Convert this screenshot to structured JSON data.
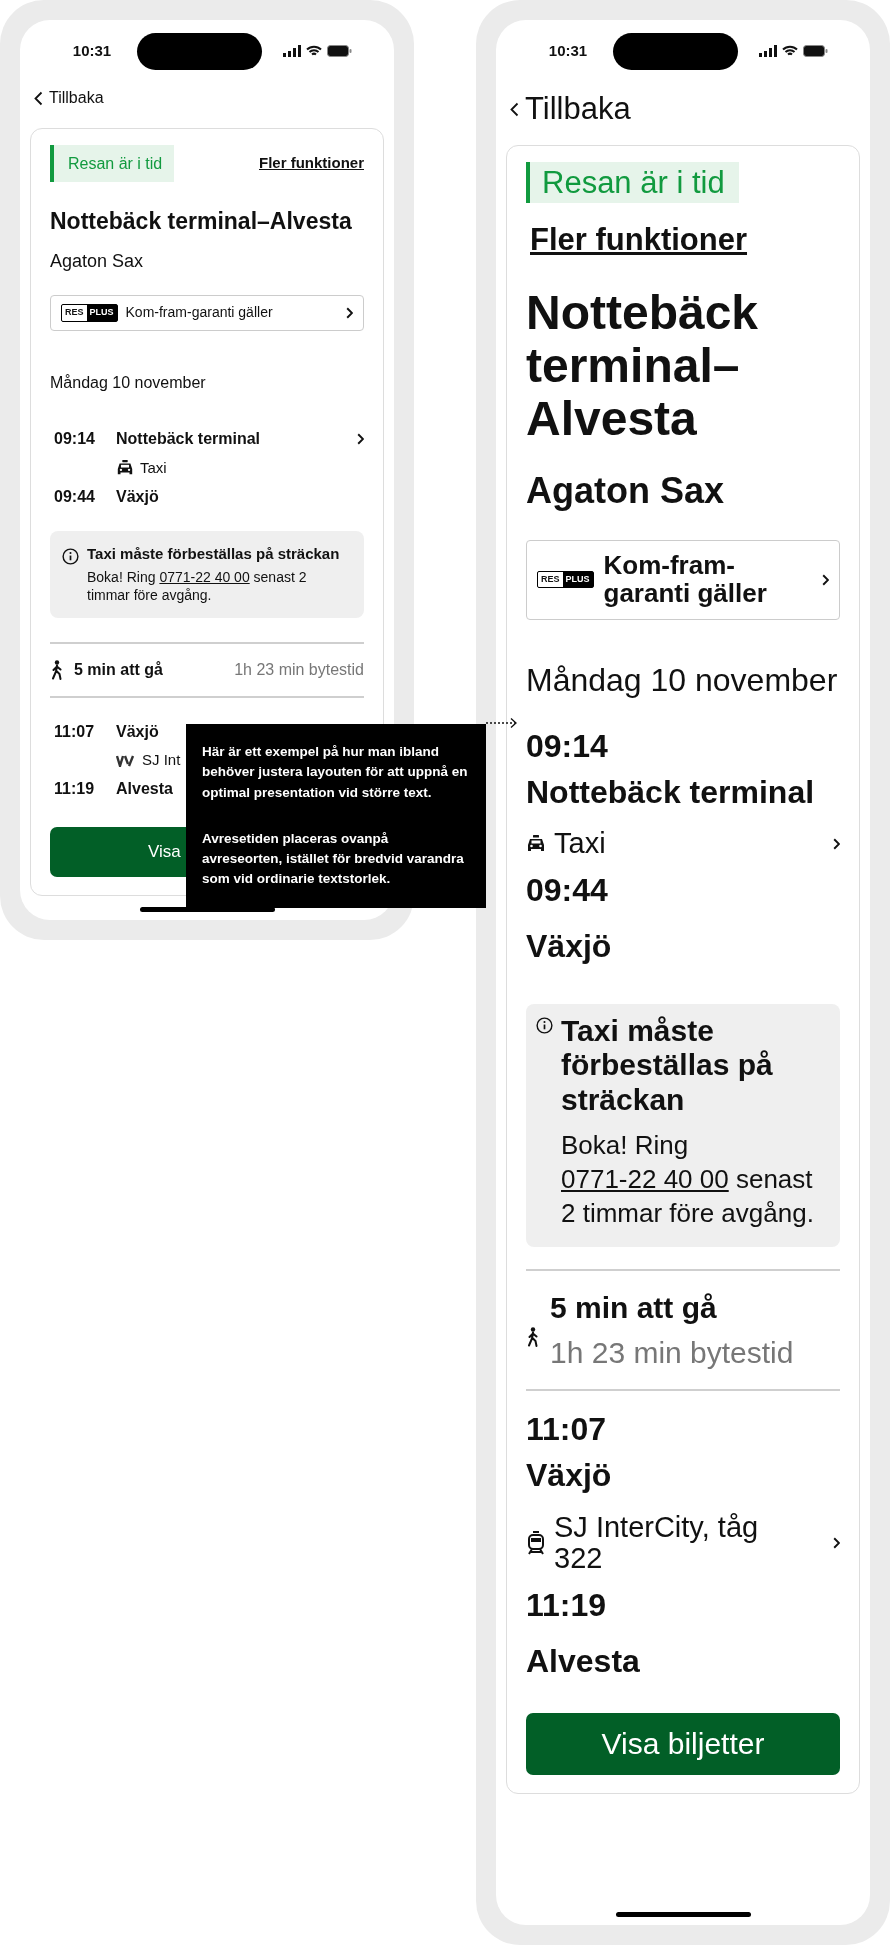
{
  "phones": [
    {
      "kind": "standard",
      "status_time": "10:31",
      "back": "Tillbaka",
      "trip_status": "Resan är i tid",
      "more_link": "Fler funktioner",
      "title": "Nottebäck terminal–Alvesta",
      "passenger": "Agaton Sax",
      "guarantee": {
        "logo_left": "RES",
        "logo_right": "PLUS",
        "label": "Kom-fram-garanti gäller"
      },
      "date": "Måndag 10 november",
      "legs": [
        {
          "departure_time": "09:14",
          "departure_stop": "Nottebäck terminal",
          "mode": {
            "kind": "taxi",
            "label": "Taxi"
          },
          "arrival_time": "09:44",
          "arrival_stop": "Växjö"
        },
        {
          "departure_time": "11:07",
          "departure_stop": "Växjö",
          "mode": {
            "kind": "operator_logo",
            "label": "SJ Int"
          },
          "arrival_time": "11:19",
          "arrival_stop": "Alvesta"
        }
      ],
      "notice": {
        "title": "Taxi måste förbeställas på sträckan",
        "before": "Boka! Ring",
        "phone": "0771-22 40 00",
        "after": "senast 2 timmar före avgång."
      },
      "transfer": {
        "walk": "5 min att gå",
        "wait": "1h 23 min bytestid"
      },
      "button": "Visa"
    },
    {
      "kind": "large",
      "status_time": "10:31",
      "back": "Tillbaka",
      "trip_status": "Resan är i tid",
      "more_link": "Fler funktioner",
      "title": "Nottebäck terminal–Alvesta",
      "passenger": "Agaton Sax",
      "guarantee": {
        "logo_left": "RES",
        "logo_right": "PLUS",
        "label": "Kom-fram-garanti gäller"
      },
      "date": "Måndag 10 november",
      "legs": [
        {
          "departure_time": "09:14",
          "departure_stop": "Nottebäck terminal",
          "mode": {
            "kind": "taxi",
            "label": "Taxi"
          },
          "arrival_time": "09:44",
          "arrival_stop": "Växjö"
        },
        {
          "departure_time": "11:07",
          "departure_stop": "Växjö",
          "mode": {
            "kind": "train",
            "label": "SJ InterCity, tåg 322"
          },
          "arrival_time": "11:19",
          "arrival_stop": "Alvesta"
        }
      ],
      "notice": {
        "title": "Taxi måste förbeställas på sträckan",
        "before": "Boka! Ring",
        "phone": "0771-22 40 00",
        "after": "senast 2 timmar före avgång."
      },
      "transfer": {
        "walk": "5 min att gå",
        "wait": "1h 23 min bytestid"
      },
      "button": "Visa biljetter"
    }
  ],
  "annotation": [
    "Här är ett exempel på hur man ibland behöver justera layouten för att uppnå en optimal presentation vid större text.",
    "Avresetiden placeras ovanpå avreseorten, istället för bredvid varandra som vid ordinarie textstorlek."
  ]
}
